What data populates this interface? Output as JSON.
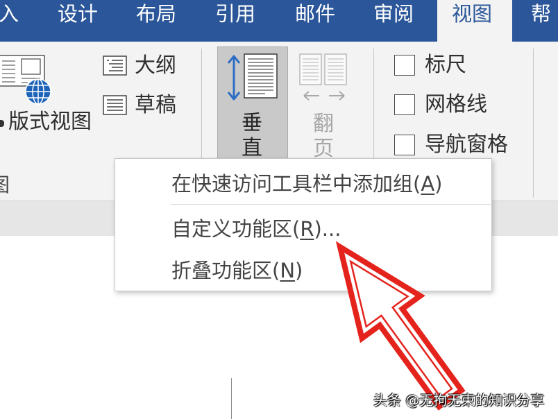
{
  "tabs": [
    {
      "label": "入"
    },
    {
      "label": "设计"
    },
    {
      "label": "布局"
    },
    {
      "label": "引用"
    },
    {
      "label": "邮件"
    },
    {
      "label": "审阅"
    },
    {
      "label": "视图",
      "selected": true
    },
    {
      "label": "帮"
    }
  ],
  "ribbon": {
    "views": {
      "web_layout": {
        "label": "版式视图",
        "icon": "web-layout-icon"
      },
      "outline": {
        "label": "大纲",
        "icon": "outline-view-icon"
      },
      "draft": {
        "label": "草稿",
        "icon": "draft-view-icon"
      },
      "group_label": "图"
    },
    "page_movement": {
      "vertical": {
        "label": "垂直",
        "icon": "vertical-scroll-icon",
        "selected": true
      },
      "side_to_side": {
        "label": "翻页",
        "icon": "side-to-side-icon",
        "enabled": false
      }
    },
    "show": {
      "checkboxes": [
        {
          "label": "标尺",
          "checked": false
        },
        {
          "label": "网格线",
          "checked": false
        },
        {
          "label": "导航窗格",
          "checked": false
        }
      ]
    }
  },
  "context_menu": {
    "items": [
      {
        "prefix": "在快速访问工具栏中添加组(",
        "accel": "A",
        "suffix": ")"
      },
      {
        "prefix": "自定义功能区(",
        "accel": "R",
        "suffix": ")..."
      },
      {
        "prefix": "折叠功能区(",
        "accel": "N",
        "suffix": ")"
      }
    ]
  },
  "watermark": "头条 @无拘无束的知识分享",
  "colors": {
    "tab_bar": "#2b579a",
    "ribbon": "#f3f3f3",
    "selected_button": "#c9c9c9",
    "disabled_text": "#a6a6a6",
    "annotation_arrow": "#e5231d"
  }
}
